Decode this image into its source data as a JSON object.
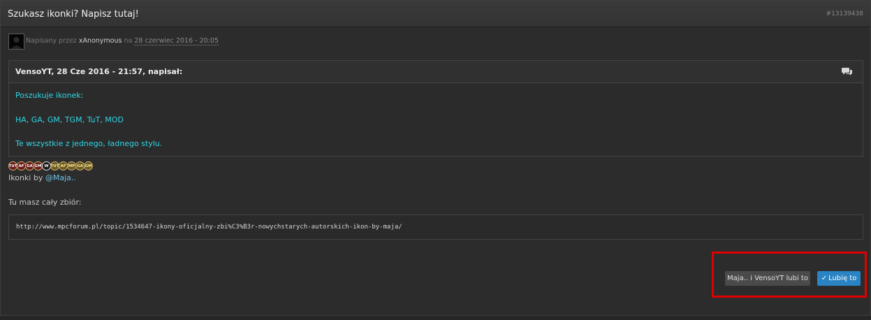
{
  "header": {
    "title": "Szukasz ikonki? Napisz tutaj!",
    "post_id": "#13139438"
  },
  "meta": {
    "prefix": "Napisany przez",
    "author": "xAnonymous",
    "on": "na",
    "date": "28 czerwiec 2016 - 20:05"
  },
  "quote": {
    "author_line": "VensoYT, 28 Cze 2016 - 21:57, napisał:",
    "icon": "comments-icon",
    "lines": [
      "Poszukuje ikonek:",
      "HA, GA, GM, TGM, TuT, MOD",
      "Te wszystkie z jednego, ładnego stylu."
    ]
  },
  "badges": [
    {
      "label": "TUT",
      "style": "red"
    },
    {
      "label": "AF",
      "style": "red"
    },
    {
      "label": "GA",
      "style": "red"
    },
    {
      "label": "GM",
      "style": "red"
    },
    {
      "label": "W",
      "style": "white"
    },
    {
      "label": "TUT",
      "style": "gold"
    },
    {
      "label": "AF",
      "style": "gold"
    },
    {
      "label": "MP",
      "style": "gold"
    },
    {
      "label": "GA",
      "style": "gold"
    },
    {
      "label": "GM",
      "style": "gold"
    }
  ],
  "signature": {
    "ikonki_prefix": "Ikonki by",
    "ikonki_mention": "@Maja..",
    "collection_text": "Tu masz cały zbiór:"
  },
  "code": {
    "url": "http://www.mpcforum.pl/topic/1534647-ikony-oficjalny-zbi%C3%B3r-nowychstarych-autorskich-ikon-by-maja/"
  },
  "likes": {
    "who_label": "Maja.. i VensoYT lubi to",
    "like_label": "Lubię to",
    "like_check": "✓"
  },
  "colors": {
    "quote_text": "#2fd6e6",
    "like_button": "#2a83c2",
    "highlight": "#e00000"
  }
}
